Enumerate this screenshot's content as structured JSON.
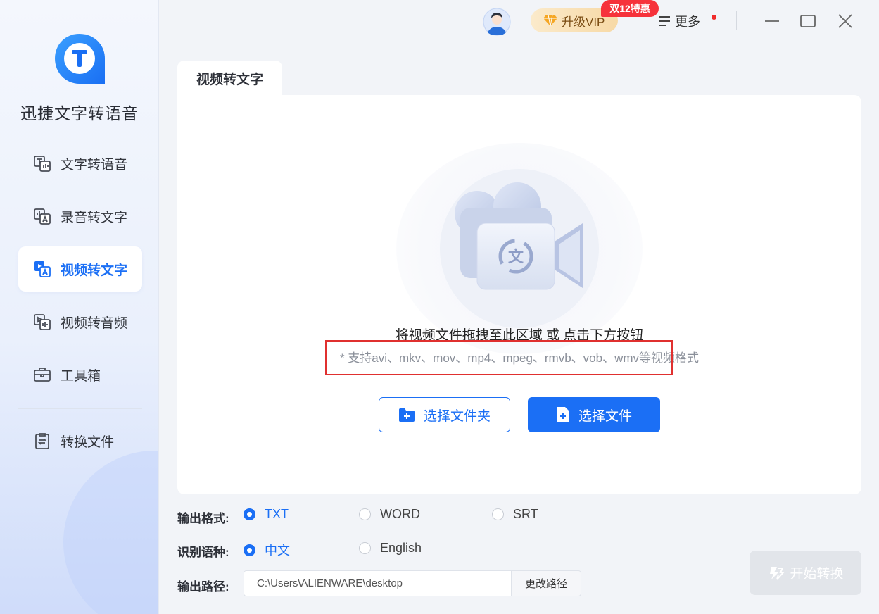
{
  "app": {
    "name": "迅捷文字转语音"
  },
  "sidebar": {
    "items": [
      {
        "label": "文字转语音",
        "icon": "text-to-speech-icon"
      },
      {
        "label": "录音转文字",
        "icon": "audio-to-text-icon"
      },
      {
        "label": "视频转文字",
        "icon": "video-to-text-icon",
        "active": true
      },
      {
        "label": "视频转音频",
        "icon": "video-to-audio-icon"
      },
      {
        "label": "工具箱",
        "icon": "toolbox-icon"
      }
    ],
    "bottom_items": [
      {
        "label": "转换文件",
        "icon": "converted-files-icon"
      }
    ]
  },
  "topbar": {
    "vip_label": "升级VIP",
    "promo_badge": "双12特惠",
    "more_label": "更多"
  },
  "main": {
    "tab_label": "视频转文字",
    "drop_hint": "将视频文件拖拽至此区域 或 点击下方按钮",
    "formats_hint": "* 支持avi、mkv、mov、mp4、mpeg、rmvb、vob、wmv等视频格式",
    "select_folder_label": "选择文件夹",
    "select_file_label": "选择文件"
  },
  "options": {
    "output_format_label": "输出格式:",
    "output_formats": [
      "TXT",
      "WORD",
      "SRT"
    ],
    "output_format_selected": "TXT",
    "language_label": "识别语种:",
    "languages": [
      "中文",
      "English"
    ],
    "language_selected": "中文",
    "output_path_label": "输出路径:",
    "output_path_value": "C:\\Users\\ALIENWARE\\desktop",
    "change_path_label": "更改路径",
    "start_label": "开始转换"
  },
  "colors": {
    "accent": "#1b6ff5",
    "promo": "#f6323b",
    "highlight_box": "#e0302f",
    "disabled_button": "#e2e5ea"
  }
}
